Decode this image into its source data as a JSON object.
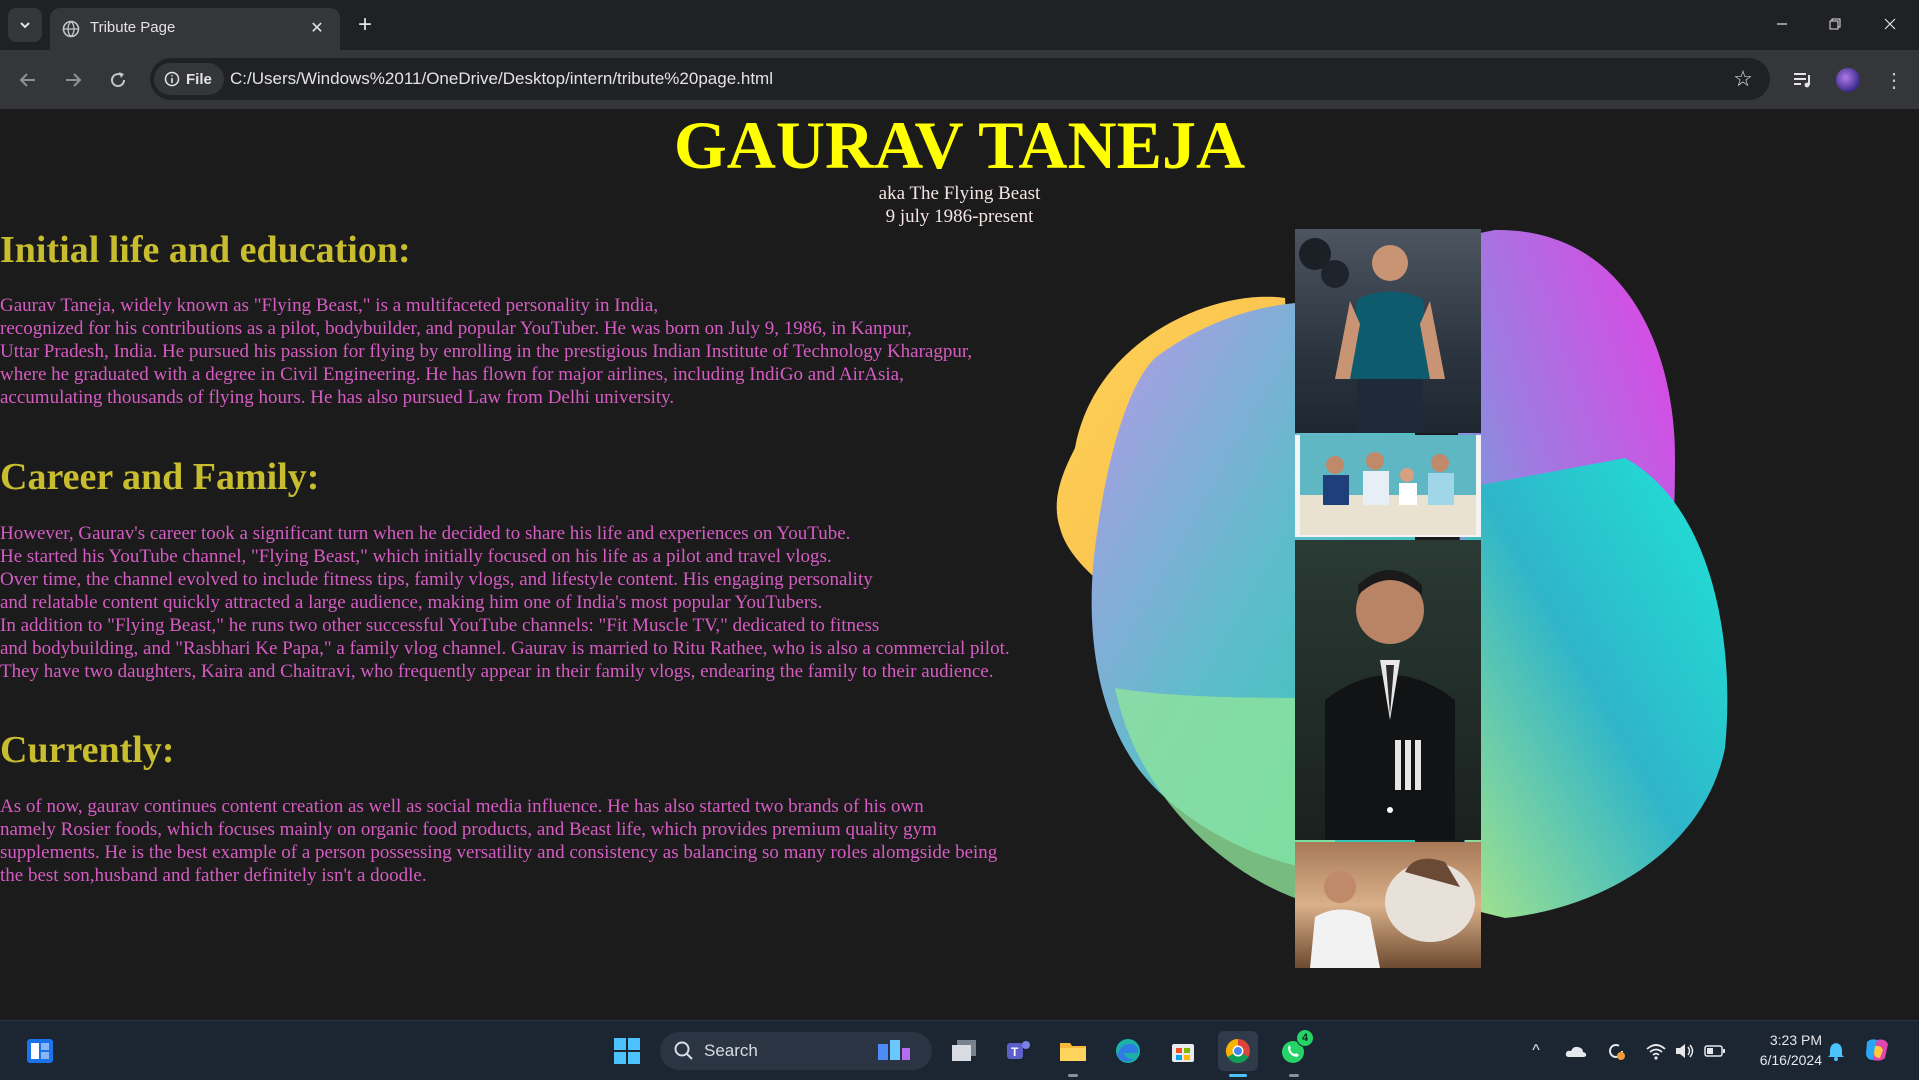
{
  "browser": {
    "tab_title": "Tribute Page",
    "site_chip_label": "File",
    "url": "C:/Users/Windows%2011/OneDrive/Desktop/intern/tribute%20page.html"
  },
  "page": {
    "heading": "GAURAV TANEJA",
    "subtitle_line1": "aka The Flying Beast",
    "subtitle_line2": "9 july 1986-present",
    "sections": [
      {
        "heading": "Initial life and education:",
        "text": "Gaurav Taneja, widely known as \"Flying Beast,\" is a multifaceted personality in India,\nrecognized for his contributions as a pilot, bodybuilder, and popular YouTuber. He was born on July 9, 1986, in Kanpur,\nUttar Pradesh, India. He pursued his passion for flying by enrolling in the prestigious Indian Institute of Technology Kharagpur,\nwhere he graduated with a degree in Civil Engineering. He has flown for major airlines, including IndiGo and AirAsia,\naccumulating thousands of flying hours. He has also pursued Law from Delhi university."
      },
      {
        "heading": "Career and Family:",
        "text": "However, Gaurav's career took a significant turn when he decided to share his life and experiences on YouTube.\nHe started his YouTube channel, \"Flying Beast,\" which initially focused on his life as a pilot and travel vlogs.\nOver time, the channel evolved to include fitness tips, family vlogs, and lifestyle content. His engaging personality\nand relatable content quickly attracted a large audience, making him one of India's most popular YouTubers.\nIn addition to \"Flying Beast,\" he runs two other successful YouTube channels: \"Fit Muscle TV,\" dedicated to fitness\nand bodybuilding, and \"Rasbhari Ke Papa,\" a family vlog channel. Gaurav is married to Ritu Rathee, who is also a commercial pilot.\nThey have two daughters, Kaira and Chaitravi, who frequently appear in their family vlogs, endearing the family to their audience."
      },
      {
        "heading": "Currently:",
        "text": "As of now, gaurav continues content creation as well as social media influence. He has also started two brands of his own\nnamely Rosier foods, which focuses mainly on organic food products, and Beast life, which provides premium quality gym\nsupplements. He is the best example of a person possessing versatility and consistency as balancing so many roles alomgside being\nthe best son,husband and father definitely isn't a doodle."
      }
    ]
  },
  "taskbar": {
    "search_label": "Search",
    "whatsapp_badge": "4",
    "time": "3:23 PM",
    "date": "6/16/2024"
  },
  "colors": {
    "heading": "#ffff00",
    "section_heading": "#c8bd2e",
    "body_text": "#d65cc4",
    "page_background": "#1b1b1b"
  }
}
